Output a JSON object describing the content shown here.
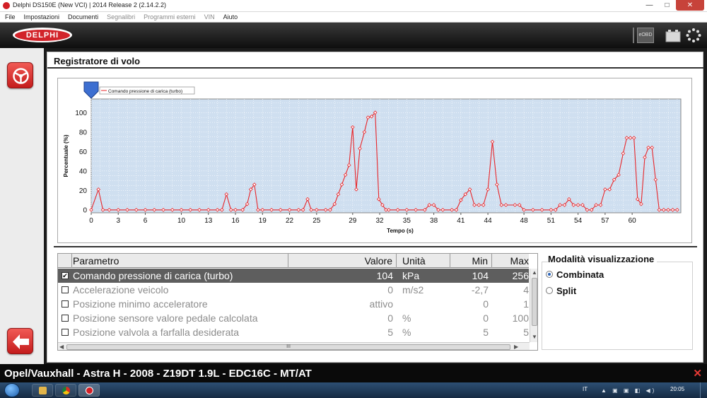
{
  "window": {
    "title": "Delphi DS150E (New VCI) | 2014 Release 2 (2.14.2.2)",
    "min": "—",
    "max": "□",
    "close": "✕"
  },
  "menu": [
    "File",
    "Impostazioni",
    "Documenti",
    "Segnalibri",
    "Programmi esterni",
    "VIN",
    "Aiuto"
  ],
  "menu_disabled": [
    "Segnalibri",
    "Programmi esterni",
    "VIN"
  ],
  "brand": {
    "logo": "DELPHI",
    "eobd": "eOBD"
  },
  "page": {
    "title": "Registratore di volo"
  },
  "chart_data": {
    "type": "line",
    "series": [
      {
        "name": "Comando pressione di carica (turbo)",
        "color": "#e8262a",
        "points": [
          [
            0,
            0
          ],
          [
            0.8,
            21
          ],
          [
            1.3,
            0
          ],
          [
            2,
            0
          ],
          [
            3,
            0
          ],
          [
            4,
            0
          ],
          [
            5,
            0
          ],
          [
            6,
            0
          ],
          [
            7,
            0
          ],
          [
            8,
            0
          ],
          [
            9,
            0
          ],
          [
            10,
            0
          ],
          [
            11,
            0
          ],
          [
            12,
            0
          ],
          [
            13,
            0
          ],
          [
            14,
            0
          ],
          [
            14.5,
            0
          ],
          [
            15,
            16
          ],
          [
            15.5,
            0
          ],
          [
            16,
            0
          ],
          [
            16.8,
            0
          ],
          [
            17.3,
            6
          ],
          [
            17.7,
            21
          ],
          [
            18.1,
            26
          ],
          [
            18.5,
            0
          ],
          [
            19,
            0
          ],
          [
            20,
            0
          ],
          [
            21,
            0
          ],
          [
            22,
            0
          ],
          [
            23,
            0
          ],
          [
            23.5,
            0
          ],
          [
            24,
            11
          ],
          [
            24.4,
            0
          ],
          [
            25,
            0
          ],
          [
            26,
            0
          ],
          [
            26.5,
            0
          ],
          [
            27,
            6
          ],
          [
            27.4,
            16
          ],
          [
            27.8,
            26
          ],
          [
            28.2,
            36
          ],
          [
            28.6,
            46
          ],
          [
            29,
            85
          ],
          [
            29.4,
            21
          ],
          [
            29.8,
            63
          ],
          [
            30.3,
            80
          ],
          [
            30.7,
            95
          ],
          [
            31.1,
            96
          ],
          [
            31.5,
            100
          ],
          [
            31.9,
            11
          ],
          [
            32.3,
            5
          ],
          [
            32.7,
            0
          ],
          [
            33,
            0
          ],
          [
            34,
            0
          ],
          [
            35,
            0
          ],
          [
            36,
            0
          ],
          [
            37,
            0
          ],
          [
            37.5,
            5
          ],
          [
            38,
            5
          ],
          [
            38.5,
            0
          ],
          [
            39,
            0
          ],
          [
            40,
            0
          ],
          [
            40.5,
            0
          ],
          [
            41,
            10
          ],
          [
            41.5,
            16
          ],
          [
            42,
            21
          ],
          [
            42.5,
            5
          ],
          [
            43,
            5
          ],
          [
            43.5,
            5
          ],
          [
            44,
            21
          ],
          [
            44.5,
            70
          ],
          [
            45,
            26
          ],
          [
            45.5,
            5
          ],
          [
            46,
            5
          ],
          [
            47,
            5
          ],
          [
            47.5,
            5
          ],
          [
            48,
            0
          ],
          [
            49,
            0
          ],
          [
            50,
            0
          ],
          [
            51,
            0
          ],
          [
            51.5,
            0
          ],
          [
            52,
            5
          ],
          [
            52.5,
            5
          ],
          [
            53,
            11
          ],
          [
            53.5,
            5
          ],
          [
            54,
            5
          ],
          [
            54.5,
            5
          ],
          [
            55,
            0
          ],
          [
            55.5,
            0
          ],
          [
            56,
            5
          ],
          [
            56.5,
            5
          ],
          [
            57,
            21
          ],
          [
            57.5,
            21
          ],
          [
            58,
            31
          ],
          [
            58.5,
            36
          ],
          [
            59,
            58
          ],
          [
            59.4,
            74
          ],
          [
            59.8,
            74
          ],
          [
            60.2,
            74
          ],
          [
            60.6,
            11
          ],
          [
            61,
            6
          ],
          [
            61.4,
            54
          ],
          [
            61.8,
            64
          ],
          [
            62.2,
            64
          ],
          [
            62.6,
            31
          ],
          [
            63,
            0
          ],
          [
            63.5,
            0
          ],
          [
            64,
            0
          ],
          [
            64.5,
            0
          ],
          [
            65,
            0
          ]
        ]
      }
    ],
    "x_ticks": [
      0,
      3,
      6,
      10,
      13,
      16,
      19,
      22,
      25,
      29,
      32,
      35,
      38,
      41,
      44,
      48,
      51,
      54,
      57,
      60
    ],
    "y_ticks": [
      0,
      20,
      40,
      60,
      80,
      100
    ],
    "xlim": [
      0,
      65.4
    ],
    "ylim": [
      -3,
      114
    ],
    "xlabel": "Tempo (s)",
    "ylabel": "Percentuale (%)",
    "grid": true,
    "legend": "top-left"
  },
  "table": {
    "headers": {
      "param": "Parametro",
      "value": "Valore",
      "unit": "Unità",
      "min": "Min",
      "max": "Max"
    },
    "rows": [
      {
        "checked": true,
        "check": "✔",
        "param": "Comando pressione di carica (turbo)",
        "value": "104",
        "unit": "kPa",
        "min": "104",
        "max": "256"
      },
      {
        "checked": false,
        "check": "",
        "param": "Accelerazione veicolo",
        "value": "0",
        "unit": "m/s2",
        "min": "-2,7",
        "max": "4"
      },
      {
        "checked": false,
        "check": "",
        "param": "Posizione minimo acceleratore",
        "value": "attivo",
        "unit": "",
        "min": "0",
        "max": "1"
      },
      {
        "checked": false,
        "check": "",
        "param": "Posizione sensore valore pedale calcolata",
        "value": "0",
        "unit": "%",
        "min": "0",
        "max": "100"
      },
      {
        "checked": false,
        "check": "",
        "param": "Posizione valvola a farfalla desiderata",
        "value": "5",
        "unit": "%",
        "min": "5",
        "max": "5"
      }
    ],
    "hscroll_grip": "III"
  },
  "display_mode": {
    "title": "Modalità visualizzazione",
    "options": [
      {
        "label": "Combinata",
        "selected": true
      },
      {
        "label": "Split",
        "selected": false
      }
    ]
  },
  "vehicle": {
    "text": "Opel/Vauxhall - Astra H - 2008 - Z19DT 1.9L - EDC16C - MT/AT",
    "close": "✕"
  },
  "taskbar": {
    "lang": "IT",
    "tray": "▲ ▣ ▣ ◧ ◀)",
    "clock": "20:05"
  }
}
